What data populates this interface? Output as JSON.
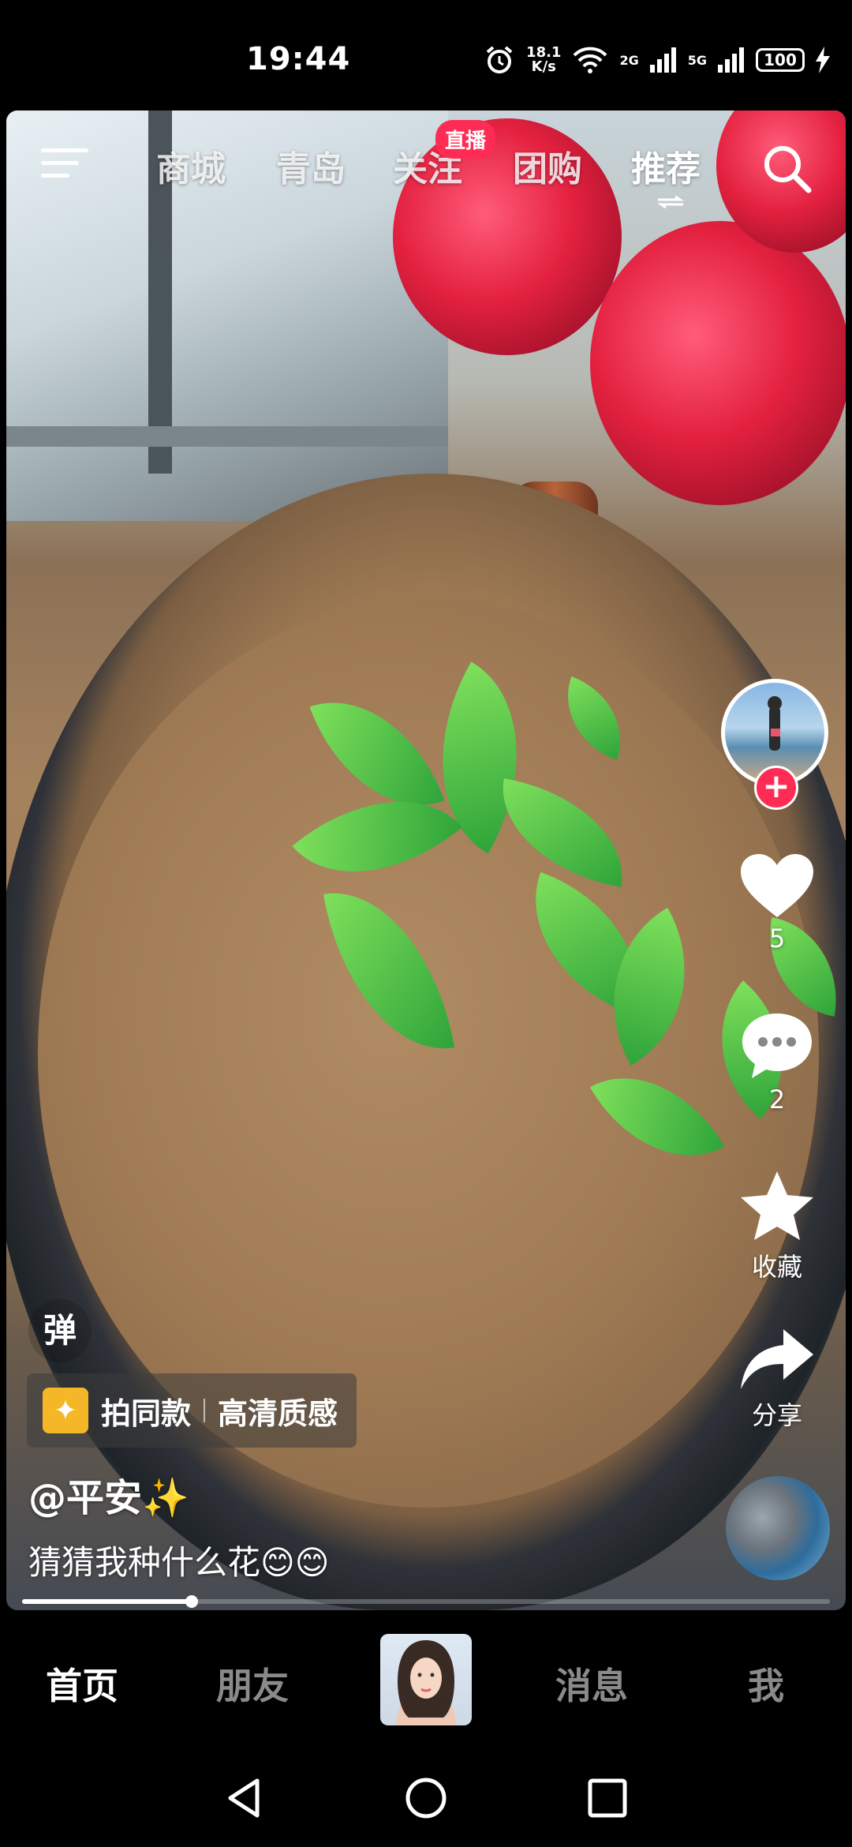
{
  "status_bar": {
    "time": "19:44",
    "speed_value": "18.1",
    "speed_unit": "K/s",
    "network_1": "2G",
    "network_2": "5G",
    "battery": "100"
  },
  "top_nav": {
    "tabs": [
      {
        "label": "商城"
      },
      {
        "label": "青岛"
      },
      {
        "label": "关注"
      },
      {
        "label": "团购"
      },
      {
        "label": "推荐"
      }
    ],
    "live_badge": "直播",
    "active_tab": "推荐"
  },
  "rail": {
    "like_count": "5",
    "comment_count": "2",
    "favorite_label": "收藏",
    "share_label": "分享"
  },
  "danmaku_label": "弹",
  "same_style": {
    "label": "拍同款",
    "quality": "高清质感"
  },
  "post": {
    "author": "@平安✨",
    "caption": "猜猜我种什么花😊😊"
  },
  "playback": {
    "progress": 0.21
  },
  "bottom_tabs": {
    "home": "首页",
    "friends": "朋友",
    "messages": "消息",
    "me": "我"
  },
  "colors": {
    "accent": "#fe2c55",
    "gift": "#f5b728"
  }
}
